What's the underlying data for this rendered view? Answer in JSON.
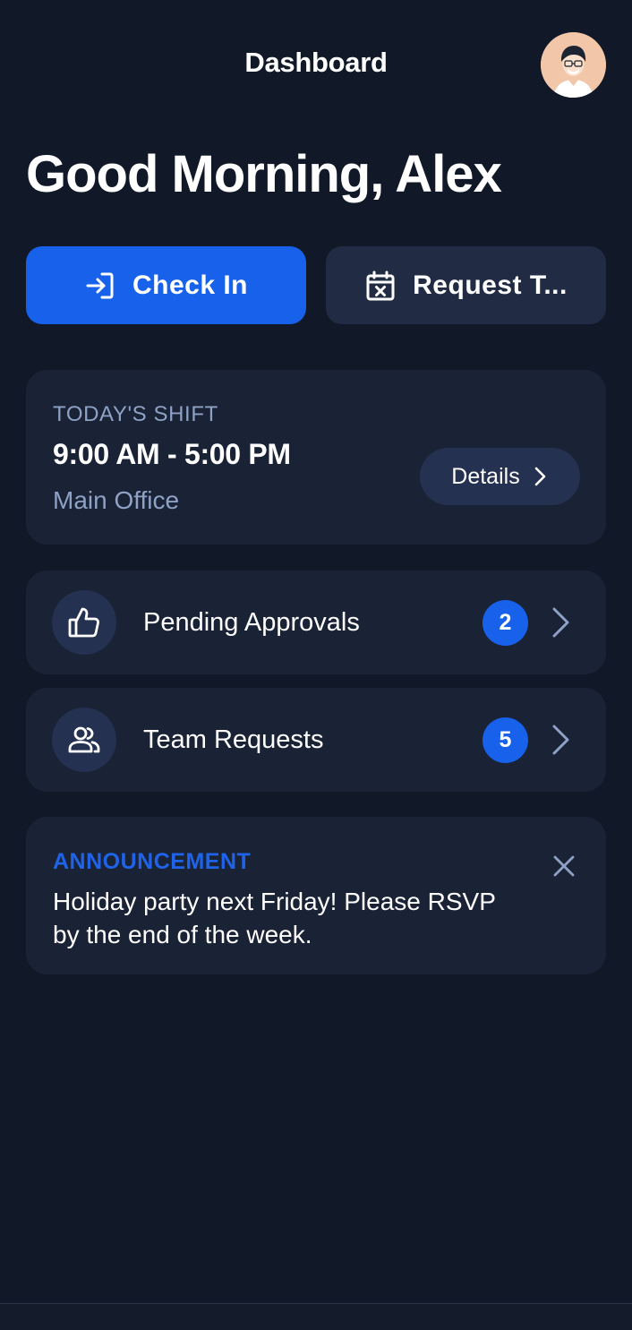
{
  "header": {
    "title": "Dashboard",
    "avatar_icon": "user-avatar"
  },
  "greeting": "Good Morning, Alex",
  "actions": {
    "check_in": {
      "label": "Check In",
      "icon": "login-arrow-icon"
    },
    "request_time_off": {
      "label": "Request T...",
      "icon": "calendar-x-icon"
    }
  },
  "shift": {
    "caption": "TODAY'S SHIFT",
    "time": "9:00 AM - 5:00 PM",
    "location": "Main Office",
    "details_label": "Details"
  },
  "rows": [
    {
      "label": "Pending Approvals",
      "count": "2",
      "icon": "thumbs-up-icon"
    },
    {
      "label": "Team Requests",
      "count": "5",
      "icon": "team-icon"
    }
  ],
  "announcement": {
    "tag": "ANNOUNCEMENT",
    "message": "Holiday party next Friday! Please RSVP by the end of the week."
  },
  "colors": {
    "background": "#111827",
    "card": "#1a2235",
    "accent": "#1761eb",
    "muted_text": "#8ea2c6"
  }
}
